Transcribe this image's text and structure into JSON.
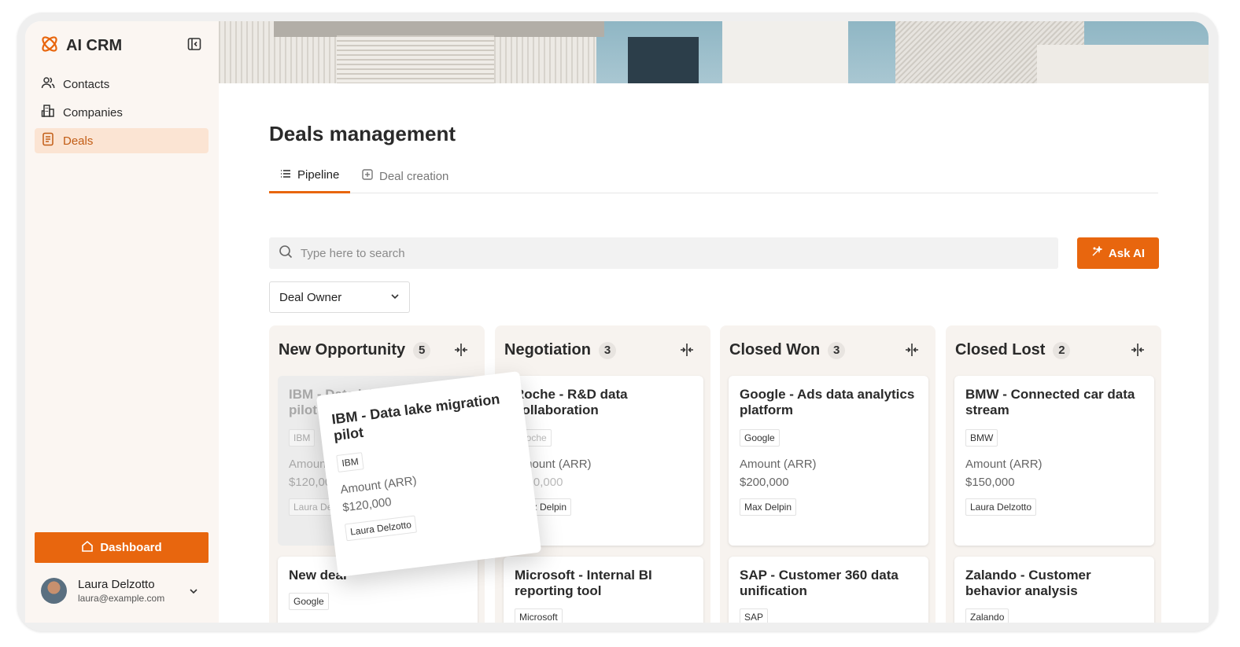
{
  "app": {
    "name": "AI CRM"
  },
  "sidebar": {
    "items": [
      {
        "label": "Contacts",
        "icon": "users-icon"
      },
      {
        "label": "Companies",
        "icon": "building-icon"
      },
      {
        "label": "Deals",
        "icon": "document-icon",
        "active": true
      }
    ],
    "dashboard_label": "Dashboard",
    "user": {
      "name": "Laura Delzotto",
      "email": "laura@example.com"
    }
  },
  "main": {
    "title": "Deals management",
    "tabs": [
      {
        "label": "Pipeline",
        "active": true
      },
      {
        "label": "Deal creation",
        "active": false
      }
    ],
    "search_placeholder": "Type here to search",
    "ask_ai_label": "Ask AI",
    "owner_filter": "Deal Owner"
  },
  "columns": [
    {
      "title": "New Opportunity",
      "count": "5",
      "cards": [
        {
          "title": "IBM - Data lake migration pilot",
          "company": "IBM",
          "amount_label": "Amount (ARR)",
          "amount": "$120,000",
          "owner": "Laura Delzotto",
          "ghost": true
        },
        {
          "title": "New deal",
          "company": "Google"
        }
      ]
    },
    {
      "title": "Negotiation",
      "count": "3",
      "cards": [
        {
          "title": "Roche - R&D data collaboration",
          "company": "Roche",
          "amount_label": "Amount (ARR)",
          "amount": "$110,000",
          "owner": "Max Delpin"
        },
        {
          "title": "Microsoft - Internal BI reporting tool",
          "company": "Microsoft"
        }
      ]
    },
    {
      "title": "Closed Won",
      "count": "3",
      "cards": [
        {
          "title": "Google - Ads data analytics platform",
          "company": "Google",
          "amount_label": "Amount (ARR)",
          "amount": "$200,000",
          "owner": "Max Delpin"
        },
        {
          "title": "SAP - Customer 360 data unification",
          "company": "SAP"
        }
      ]
    },
    {
      "title": "Closed Lost",
      "count": "2",
      "cards": [
        {
          "title": "BMW - Connected car data stream",
          "company": "BMW",
          "amount_label": "Amount (ARR)",
          "amount": "$150,000",
          "owner": "Laura Delzotto"
        },
        {
          "title": "Zalando - Customer behavior analysis",
          "company": "Zalando"
        }
      ]
    }
  ],
  "dragged_card": {
    "title": "IBM - Data lake migration pilot",
    "company": "IBM",
    "amount_label": "Amount (ARR)",
    "amount": "$120,000",
    "owner": "Laura Delzotto"
  },
  "colors": {
    "accent": "#e8660e",
    "sidebar_bg": "#fbf6f2",
    "active_nav_bg": "#fbe4d3"
  }
}
